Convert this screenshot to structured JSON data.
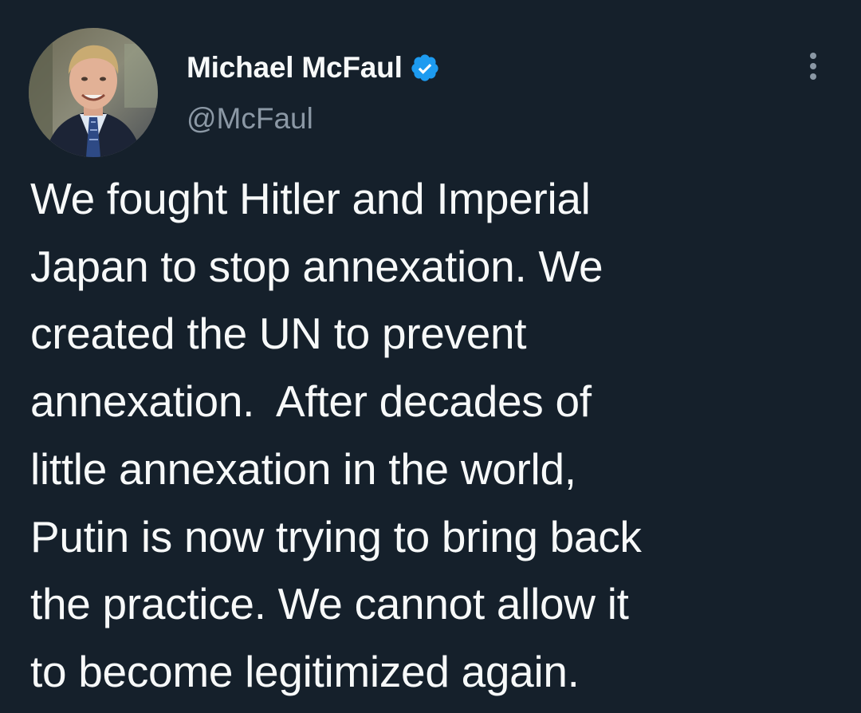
{
  "author": {
    "display_name": "Michael McFaul",
    "handle": "@McFaul",
    "verified": true
  },
  "tweet": {
    "text": "We fought Hitler and Imperial\nJapan to stop annexation. We\ncreated the UN to prevent\nannexation.  After decades of\nlittle annexation in the world,\nPutin is now trying to bring back\nthe practice. We cannot allow it\nto become legitimized again."
  },
  "icons": {
    "verified": "verified-badge-icon",
    "more": "more-options-icon"
  },
  "colors": {
    "background": "#15202b",
    "text": "#f7f9f9",
    "secondary_text": "#8b98a5",
    "verified_blue": "#1d9bf0"
  }
}
